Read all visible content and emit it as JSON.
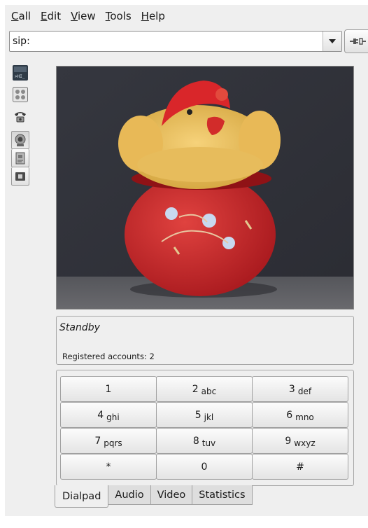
{
  "menubar": [
    {
      "accel": "C",
      "rest": "all"
    },
    {
      "accel": "E",
      "rest": "dit"
    },
    {
      "accel": "V",
      "rest": "iew"
    },
    {
      "accel": "T",
      "rest": "ools"
    },
    {
      "accel": "H",
      "rest": "elp"
    }
  ],
  "address": {
    "value": "sip:"
  },
  "icons": {
    "dropdown": "chevron-down-icon",
    "call": "plug-connect-icon",
    "toolbar": [
      "console-icon",
      "contacts-grid-icon",
      "phone-icon",
      "webcam-icon",
      "address-book-icon",
      "video-window-icon"
    ]
  },
  "status": {
    "text": "Standby",
    "accounts": "Registered accounts: 2"
  },
  "dialpad": [
    {
      "digit": "1",
      "letters": ""
    },
    {
      "digit": "2",
      "letters": "abc"
    },
    {
      "digit": "3",
      "letters": "def"
    },
    {
      "digit": "4",
      "letters": "ghi"
    },
    {
      "digit": "5",
      "letters": "jkl"
    },
    {
      "digit": "6",
      "letters": "mno"
    },
    {
      "digit": "7",
      "letters": "pqrs"
    },
    {
      "digit": "8",
      "letters": "tuv"
    },
    {
      "digit": "9",
      "letters": "wxyz"
    },
    {
      "digit": "*",
      "letters": ""
    },
    {
      "digit": "0",
      "letters": ""
    },
    {
      "digit": "#",
      "letters": ""
    }
  ],
  "tabs": [
    "Dialpad",
    "Audio",
    "Video",
    "Statistics"
  ],
  "active_tab": "Dialpad"
}
